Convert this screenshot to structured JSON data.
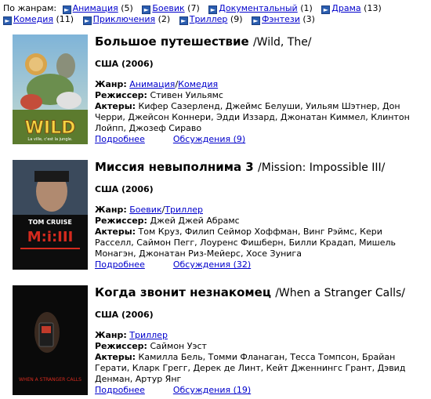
{
  "genres": {
    "label": "По жанрам:",
    "items": [
      {
        "name": "Анимация",
        "count": "(5)"
      },
      {
        "name": "Боевик",
        "count": "(7)"
      },
      {
        "name": "Документальный",
        "count": "(1)"
      },
      {
        "name": "Драма",
        "count": "(13)"
      },
      {
        "name": "Комедия",
        "count": "(11)"
      },
      {
        "name": "Приключения",
        "count": "(2)"
      },
      {
        "name": "Триллер",
        "count": "(9)"
      },
      {
        "name": "Фэнтези",
        "count": "(3)"
      }
    ]
  },
  "labels": {
    "genre": "Жанр:",
    "director": "Режиссер:",
    "actors": "Актеры:",
    "more": "Подробнее"
  },
  "movies": [
    {
      "title": "Большое путешествие",
      "original": "/Wild, The/",
      "country": "США (2006)",
      "genres": [
        "Анимация",
        "Комедия"
      ],
      "director": "Стивен Уильямс",
      "actors": "Кифер Сазерленд, Джеймс Белуши, Уильям Шэтнер, Дон Черри, Джейсон Коннери, Эдди Иззард, Джонатан Киммел, Клинтон Лойпп, Джозеф Сираво",
      "discussion": "Обсуждения (9)",
      "poster_text": "WILD",
      "poster_subtitle": "La ville, c'est la jungle."
    },
    {
      "title": "Миссия невыполнима 3",
      "original": "/Mission: Impossible III/",
      "country": "США (2006)",
      "genres": [
        "Боевик",
        "Триллер"
      ],
      "director": "Джей Джей Абрамс",
      "actors": "Том Круз, Филип Сеймор Хоффман, Винг Рэймс, Кери Расселл, Саймон Пегг, Лоуренс Фишберн, Билли Крадап, Мишель Монагэн, Джонатан Риз-Мейерс, Хосе Зунига",
      "discussion": "Обсуждения (32)",
      "poster_text": "M:i:III",
      "poster_subtitle": "TOM CRUISE"
    },
    {
      "title": "Когда звонит незнакомец",
      "original": "/When a Stranger Calls/",
      "country": "США (2006)",
      "genres": [
        "Триллер"
      ],
      "director": "Саймон Уэст",
      "actors": "Камилла Бель, Томми Фланаган, Тесса Томпсон, Брайан Герати, Кларк Грегг, Дерек де Линт, Кейт Дженнингс Грант, Дэвид Денман, Артур Янг",
      "discussion": "Обсуждения (19)",
      "poster_text": "WHEN A STRANGER CALLS"
    }
  ]
}
